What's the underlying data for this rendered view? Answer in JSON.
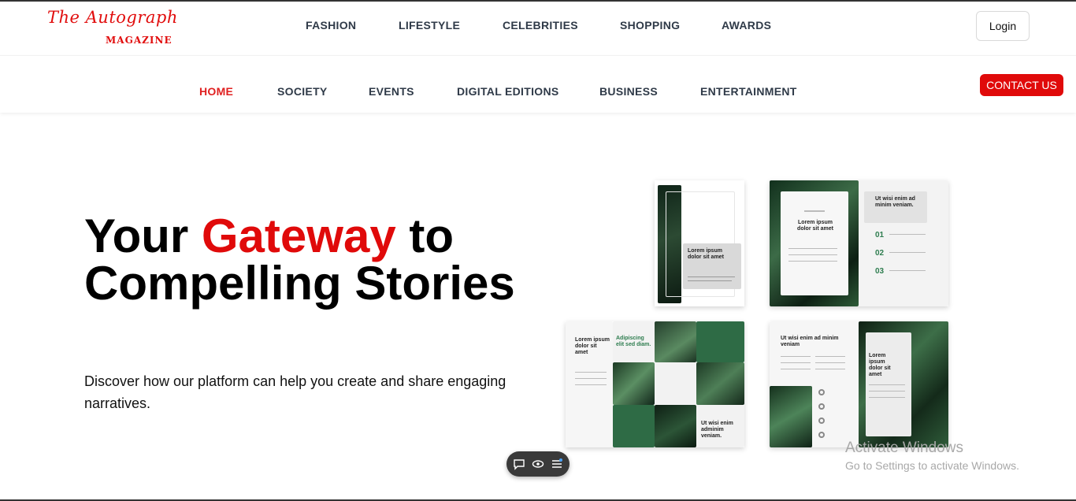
{
  "brand": {
    "script": "The Autograph",
    "sub": "MAGAZINE",
    "color": "#e10d0d"
  },
  "main_nav": [
    "FASHION",
    "LIFESTYLE",
    "CELEBRITIES",
    "SHOPPING",
    "AWARDS"
  ],
  "login_label": "Login",
  "sub_nav": [
    "HOME",
    "SOCIETY",
    "EVENTS",
    "DIGITAL EDITIONS",
    "BUSINESS",
    "ENTERTAINMENT"
  ],
  "active_sub_nav": "HOME",
  "contact_label": "CONTACT US",
  "hero": {
    "title_part1": "Your ",
    "title_accent": "Gateway",
    "title_part2": " to Compelling Stories",
    "subtitle": "Discover how our platform can help you create and share engaging narratives."
  },
  "magazine": {
    "m1_text": "Lorem ipsum dolor sit amet",
    "m2_left": "Lorem ipsum dolor sit amet",
    "m2_right": "Ut wisi enim ad minim veniam.",
    "m2_numbers": [
      "01",
      "02",
      "03"
    ],
    "m3_left": "Lorem ipsum dolor sit amet",
    "m3_mid": "Adipiscing elit sed diam.",
    "m3_right": "Ut wisi enim adminim veniam.",
    "m4_left": "Ut wisi enim ad minim veniam",
    "m4_right": "Lorem ipsum dolor sit amet"
  },
  "floating_toolbar": {
    "icons": [
      "chat-icon",
      "eye-icon",
      "menu-icon"
    ]
  },
  "watermark": {
    "line1": "Activate Windows",
    "line2": "Go to Settings to activate Windows."
  },
  "colors": {
    "accent": "#e00a0a",
    "nav_text": "#2f3a48",
    "green": "#2e7d4f"
  }
}
